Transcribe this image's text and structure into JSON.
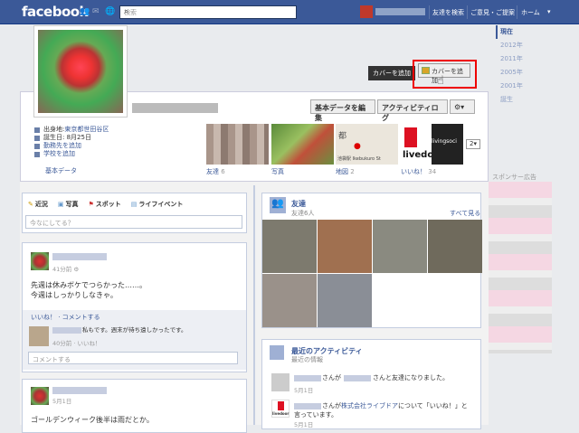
{
  "topbar": {
    "logo": "facebook",
    "search_placeholder": "検索",
    "links": [
      "友達を検索",
      "ご意見・ご提案",
      "ホーム"
    ]
  },
  "profile": {
    "edit_basic": "基本データを編集",
    "activity_log": "アクティビティログ",
    "cover_tooltip": "カバーを追加",
    "cover_button": "カバーを追加",
    "info": {
      "hometown_label": "出身地:",
      "hometown_value": "東京都世田谷区",
      "birthday": "誕生日: 8月25日",
      "add_work": "勤務先を追加",
      "add_school": "学校を追加"
    },
    "basic_data": "基本データ"
  },
  "tiles": [
    {
      "label": "友達",
      "count": "6"
    },
    {
      "label": "写真",
      "count": ""
    },
    {
      "label": "地図",
      "count": "2"
    },
    {
      "label": "いいね！",
      "count": "34"
    }
  ],
  "tile_text": {
    "map_caption": "池袋駅 Ikebukuro St",
    "map_city": "都",
    "livedoor": "livedoor",
    "livingsocial": "livingsoci"
  },
  "dropdown": "2",
  "timeline": [
    "現在",
    "2012年",
    "2011年",
    "2005年",
    "2001年",
    "誕生"
  ],
  "sponsor": "スポンサー広告",
  "composer": {
    "tabs": [
      "近況",
      "写真",
      "スポット",
      "ライフイベント"
    ],
    "placeholder": "今なにしてる？"
  },
  "post1": {
    "time": "41分前",
    "text1": "先週は休みボケでつらかった……。",
    "text2": "今週はしっかりしなきゃ。",
    "actions": "いいね！ · コメントする",
    "reply_text": "私もです。週末が待ち遠しかったです。",
    "reply_time": "40分前 · いいね！",
    "comment_placeholder": "コメントする"
  },
  "post2": {
    "time": "5月1日",
    "text": "ゴールデンウィーク後半は雨だとか。"
  },
  "friends": {
    "title": "友達",
    "sub": "友達6人",
    "see_all": "すべて見る"
  },
  "activity": {
    "title": "最近のアクティビティ",
    "sub": "最近の情報",
    "row1_a": "さんが",
    "row1_b": "さんと友達になりました。",
    "row1_date": "5月1日",
    "row2_a": "さんが",
    "row2_company": "株式会社ライブドア",
    "row2_b": "について「いいね！」と",
    "row2_c": "言っています。",
    "row2_date": "5月1日",
    "row2_logo": "livedoor"
  }
}
